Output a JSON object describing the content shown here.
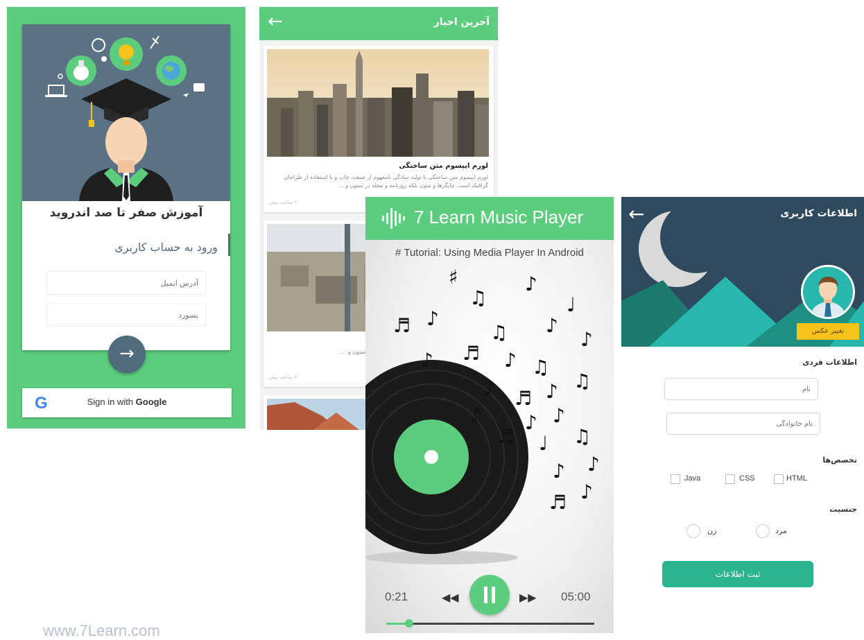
{
  "login": {
    "app_title": "آموزش صفر تا صد اندروید",
    "login_title": "ورود به حساب کاربری",
    "email_placeholder": "آدرس ایمیل",
    "password_placeholder": "پسورد",
    "google_letter": "G",
    "google_text_prefix": "Sign in with ",
    "google_text_brand": "Google"
  },
  "news": {
    "title": "آخرین اخبار",
    "items": [
      {
        "title": "لورم ایپسوم متن ساختگی",
        "body": "لورم ایپسوم متن ساختگی با تولید سادگی نامفهوم از صنعت چاپ و با استفاده از طراحان گرافیک است. چاپگرها و متون بلکه روزنامه و مجله در ستون و ...",
        "time": "۲ ساعت پیش"
      },
      {
        "title": "",
        "body": "هوم از صنعت چاپ و با استفاده ه روزنامه و مجله در ستون و ...",
        "time": "۳ ساعت پیش"
      }
    ]
  },
  "music": {
    "title": "7 Learn Music Player",
    "subtitle": "# Tutorial: Using Media Player In Android",
    "current_time": "0:21",
    "total_time": "05:00",
    "progress": 0.11
  },
  "profile": {
    "title": "اطلاعات کاربری",
    "change_photo": "تغییر عکس",
    "personal_section": "اطلاعات فردی",
    "first_name_placeholder": "نام",
    "last_name_placeholder": "نام خانوادگی",
    "skills_section": "تخصص‌ها",
    "skills": [
      "HTML",
      "CSS",
      "Java"
    ],
    "gender_section": "جنسیت",
    "genders": [
      "مرد",
      "زن"
    ],
    "submit": "ثبت اطلاعات"
  },
  "footer_url": "www.7Learn.com",
  "colors": {
    "primary": "#5ccd7e",
    "slate": "#4f6b7c",
    "navy": "#2f4a5f",
    "teal": "#2ab58f",
    "yellow": "#f7c21a"
  }
}
